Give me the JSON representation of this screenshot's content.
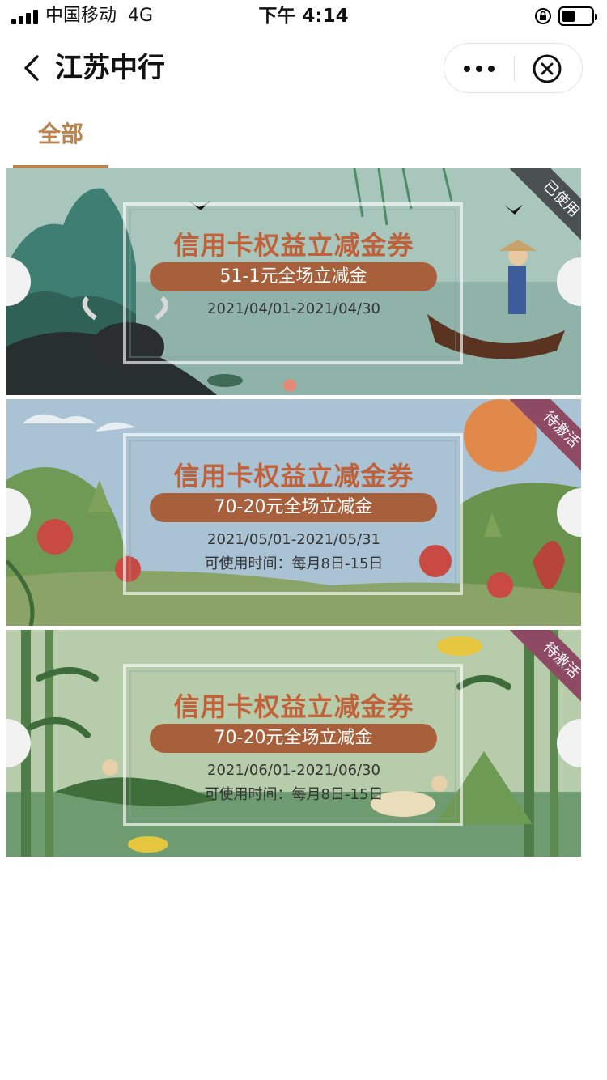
{
  "status_bar": {
    "carrier": "中国移动",
    "network": "4G",
    "time": "下午 4:14",
    "battery_level": 0.45
  },
  "nav": {
    "title": "江苏中行",
    "back_icon": "chevron-left-icon",
    "more_icon": "more-dots-icon",
    "close_icon": "close-circle-icon"
  },
  "tabs": [
    {
      "label": "全部",
      "active": true
    }
  ],
  "colors": {
    "accent": "#b8834e",
    "pill": "#a8603c",
    "title_red": "#c0613a",
    "ribbon_used": "#4a4f50",
    "ribbon_pending": "#8e4a63"
  },
  "coupons": [
    {
      "title": "信用卡权益立减金券",
      "amount": "51-1元全场立减金",
      "date_range": "2021/04/01-2021/04/30",
      "status": "已使用",
      "theme": "spring-rain"
    },
    {
      "title": "信用卡权益立减金券",
      "amount": "70-20元全场立减金",
      "date_range": "2021/05/01-2021/05/31",
      "usage_time": "可使用时间：每月8日-15日",
      "status": "待激活",
      "theme": "summer-flowers"
    },
    {
      "title": "信用卡权益立减金券",
      "amount": "70-20元全场立减金",
      "date_range": "2021/06/01-2021/06/30",
      "usage_time": "可使用时间：每月8日-15日",
      "status": "待激活",
      "theme": "dragon-boat-bamboo"
    }
  ]
}
